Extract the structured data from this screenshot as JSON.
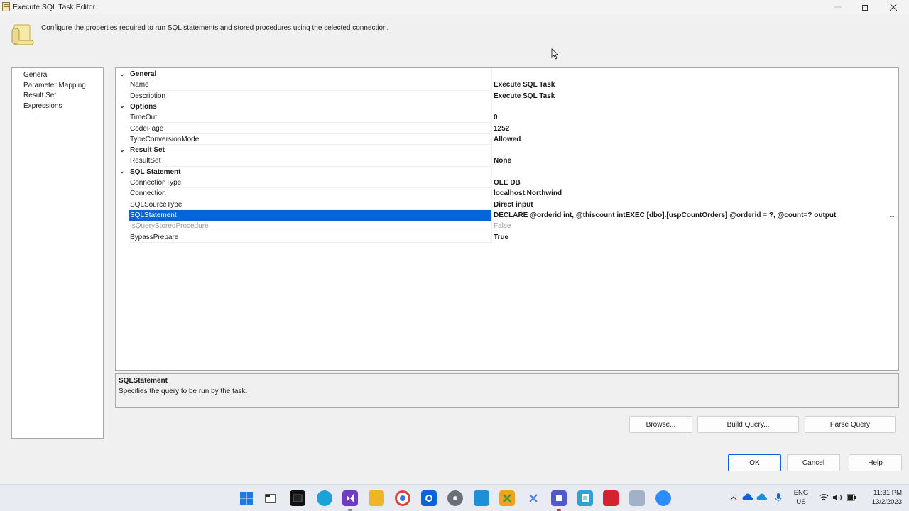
{
  "window": {
    "title": "Execute SQL Task Editor",
    "header_text": "Configure the properties required to run SQL statements and stored procedures using the selected connection."
  },
  "nav": {
    "items": [
      {
        "label": "General"
      },
      {
        "label": "Parameter Mapping"
      },
      {
        "label": "Result Set"
      },
      {
        "label": "Expressions"
      }
    ]
  },
  "grid": {
    "categories": {
      "general": "General",
      "options": "Options",
      "result_set": "Result Set",
      "sql_statement": "SQL Statement"
    },
    "rows": {
      "name": {
        "name": "Name",
        "value": "Execute SQL Task"
      },
      "description": {
        "name": "Description",
        "value": "Execute SQL Task"
      },
      "timeout": {
        "name": "TimeOut",
        "value": "0"
      },
      "codepage": {
        "name": "CodePage",
        "value": "1252"
      },
      "typeconversion": {
        "name": "TypeConversionMode",
        "value": "Allowed"
      },
      "resultset": {
        "name": "ResultSet",
        "value": "None"
      },
      "connectiontype": {
        "name": "ConnectionType",
        "value": "OLE DB"
      },
      "connection": {
        "name": "Connection",
        "value": "localhost.Northwind"
      },
      "sqlsourcetype": {
        "name": "SQLSourceType",
        "value": "Direct input"
      },
      "sqlstatement": {
        "name": "SQLStatement",
        "value": "DECLARE @orderid int, @thiscount intEXEC [dbo].[uspCountOrders] @orderid = ?, @count=? output"
      },
      "isquerystoredprocedure": {
        "name": "IsQueryStoredProcedure",
        "value": "False"
      },
      "bypassprepare": {
        "name": "BypassPrepare",
        "value": "True"
      }
    },
    "ellipsis": "..."
  },
  "description_panel": {
    "title": "SQLStatement",
    "text": "Specifies the query to be run by the task."
  },
  "buttons": {
    "browse": "Browse...",
    "build_query": "Build Query...",
    "parse_query": "Parse Query",
    "ok": "OK",
    "cancel": "Cancel",
    "help": "Help"
  },
  "taskbar": {
    "lang_line1": "ENG",
    "lang_line2": "US",
    "time": "11:31 PM",
    "date": "13/2/2023",
    "icons": [
      "windows-start",
      "file-explorer-window",
      "terminal",
      "edge",
      "visual-studio",
      "file-explorer",
      "chrome",
      "outlook",
      "settings",
      "remote-connect",
      "tool",
      "snip",
      "teams",
      "notepad",
      "acrobat",
      "network-tool",
      "zoom"
    ]
  },
  "colors": {
    "selection": "#0a64d6",
    "border": "#a9a9a9",
    "background": "#f0f0f0"
  }
}
